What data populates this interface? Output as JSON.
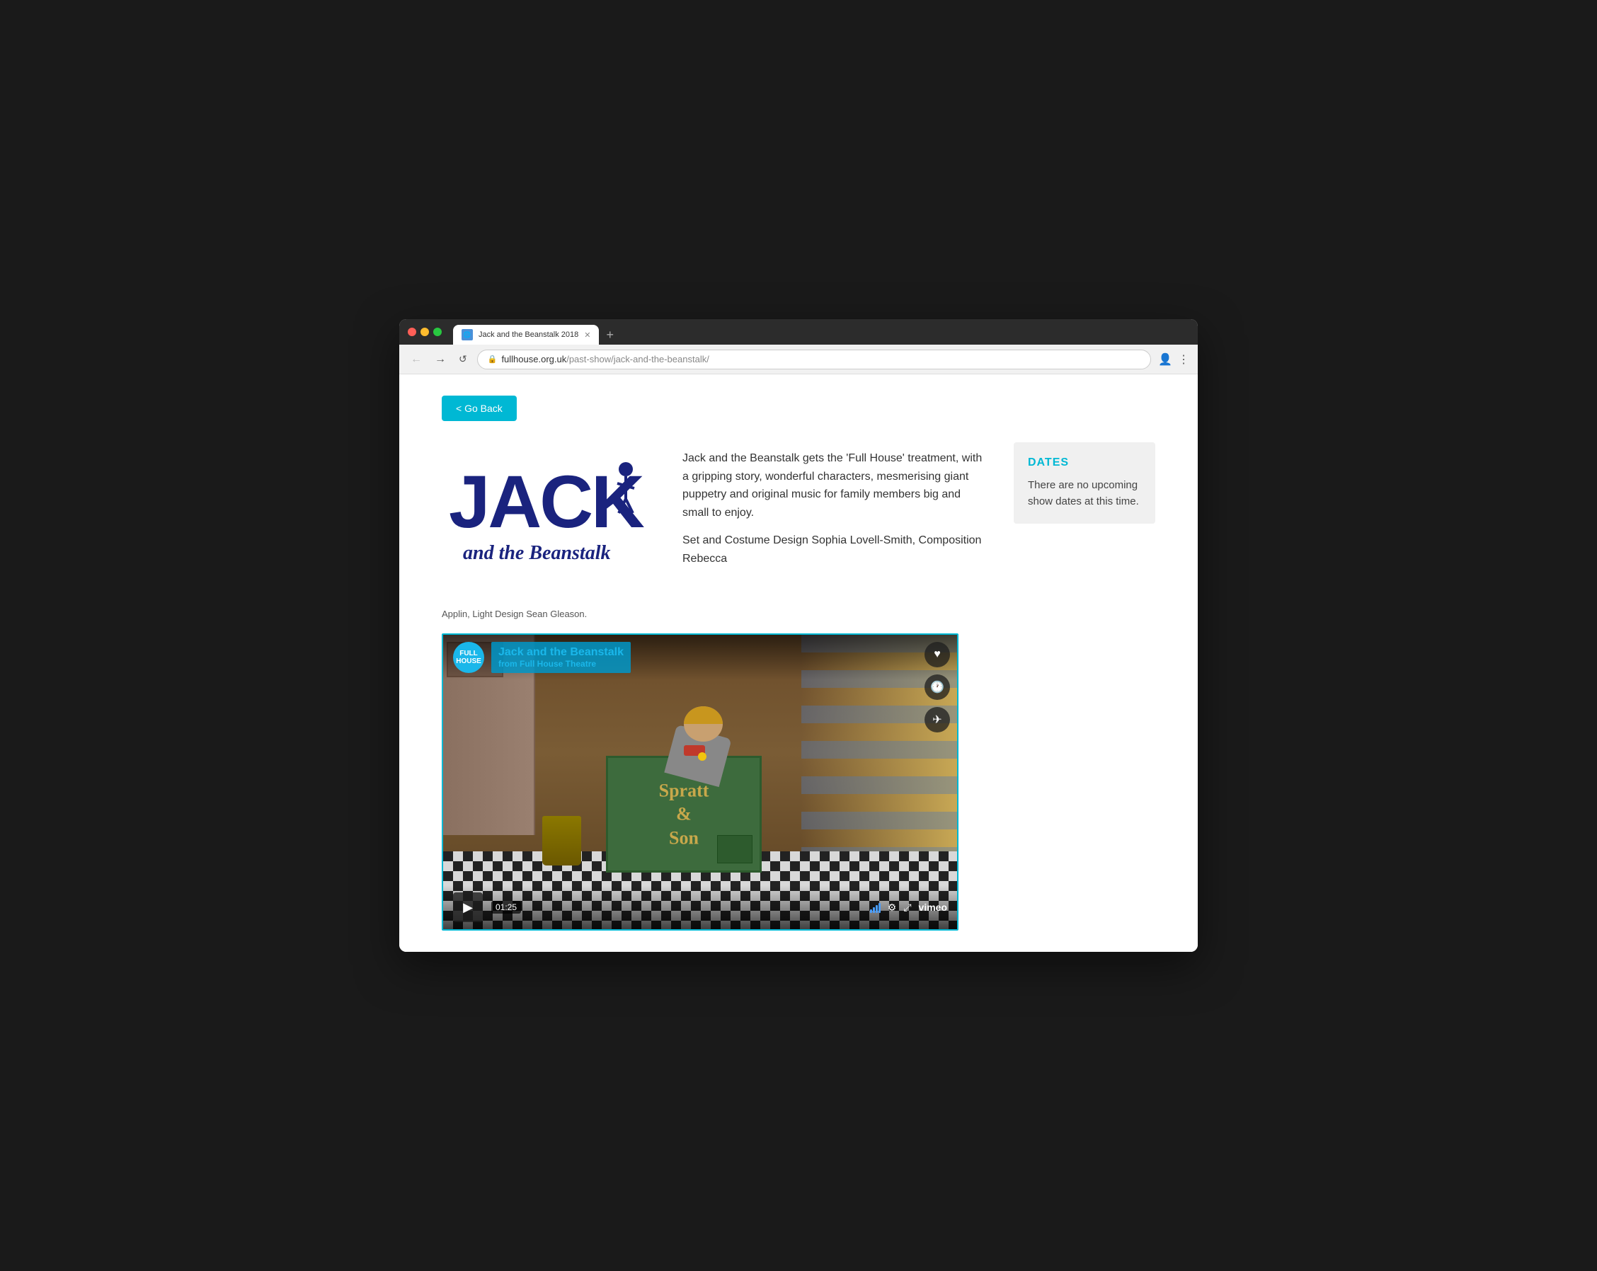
{
  "browser": {
    "tab_title": "Jack and the Beanstalk 2018",
    "tab_favicon": "🌐",
    "url_protocol": "https://",
    "url_domain": "fullhouse.org.uk",
    "url_path": "/past-show/jack-and-the-beanstalk/",
    "new_tab_label": "+"
  },
  "go_back_button": "< Go Back",
  "show": {
    "title_word1": "JACK",
    "title_subtitle": "and the Beanstalk",
    "description": "Jack and the Beanstalk gets the 'Full House' treatment, with a gripping story, wonderful characters, mesmerising giant puppetry and original music for family members big and small to enjoy.",
    "credits_line1": "Set and Costume Design Sophia Lovell-Smith, Composition Rebecca",
    "credits_line2": "Applin, Light Design Sean Gleason."
  },
  "dates_sidebar": {
    "title": "DATES",
    "message": "There are no upcoming show dates at this time."
  },
  "video": {
    "show_title": "Jack and the Beanstalk",
    "from_label": "from",
    "channel": "Full House Theatre",
    "logo_line1": "FULL",
    "logo_line2": "HOUSE",
    "time": "01:25",
    "vimeo_brand": "vimeo",
    "play_label": "▶"
  },
  "icons": {
    "back": "←",
    "forward": "→",
    "reload": "↺",
    "lock": "🔒",
    "account": "👤",
    "more": "⋮",
    "heart": "♥",
    "clock": "🕐",
    "share": "✈",
    "gear": "⚙",
    "expand": "⤢"
  }
}
